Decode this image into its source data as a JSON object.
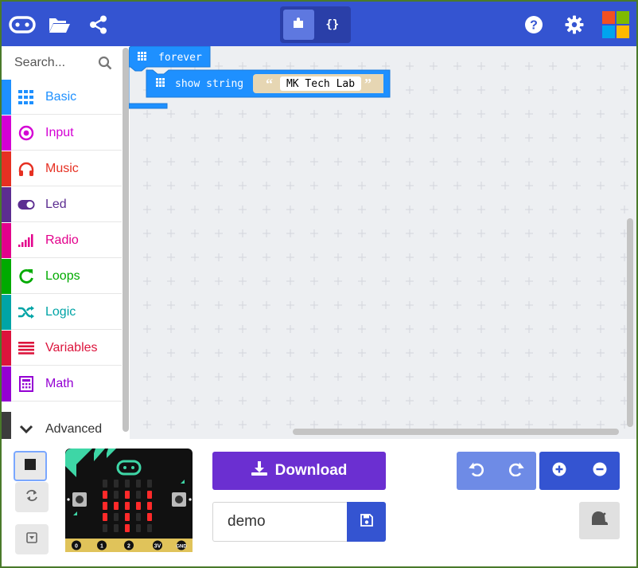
{
  "header": {
    "view_toggle": {
      "blocks_icon": "puzzle-icon",
      "javascript_label": "{}"
    },
    "left_icons": [
      "microbit-logo-icon",
      "folder-open-icon",
      "share-icon"
    ],
    "right_icons": [
      "help-icon",
      "gear-icon"
    ],
    "microsoft_logo_colors": [
      "#f25022",
      "#7fba00",
      "#00a4ef",
      "#ffb900"
    ]
  },
  "toolbox": {
    "search": {
      "placeholder": "Search..."
    },
    "categories": [
      {
        "label": "Basic",
        "color": "#1e90ff",
        "icon": "grid-icon"
      },
      {
        "label": "Input",
        "color": "#d400d4",
        "icon": "target-icon"
      },
      {
        "label": "Music",
        "color": "#e63022",
        "icon": "headphones-icon"
      },
      {
        "label": "Led",
        "color": "#5c2d91",
        "icon": "toggle-icon"
      },
      {
        "label": "Radio",
        "color": "#e3008c",
        "icon": "signal-bars-icon"
      },
      {
        "label": "Loops",
        "color": "#00aa00",
        "icon": "refresh-icon"
      },
      {
        "label": "Logic",
        "color": "#00a4a6",
        "icon": "shuffle-icon"
      },
      {
        "label": "Variables",
        "color": "#dc143c",
        "icon": "lines-icon"
      },
      {
        "label": "Math",
        "color": "#9400d3",
        "icon": "calculator-icon"
      }
    ],
    "advanced_label": "Advanced"
  },
  "workspace": {
    "forever_block": {
      "label": "forever",
      "color": "#1e90ff"
    },
    "show_string_block": {
      "label": "show string",
      "value": "MK Tech Lab",
      "open_quote": "“",
      "close_quote": "”"
    }
  },
  "simulator": {
    "pins": [
      "0",
      "1",
      "2",
      "3V",
      "GND"
    ],
    "led_matrix": [
      [
        0,
        0,
        0,
        0,
        0
      ],
      [
        1,
        0,
        1,
        0,
        1
      ],
      [
        1,
        1,
        1,
        1,
        1
      ],
      [
        1,
        0,
        1,
        0,
        1
      ],
      [
        0,
        0,
        1,
        0,
        0
      ]
    ]
  },
  "actions": {
    "download_label": "Download",
    "project_name": "demo"
  }
}
